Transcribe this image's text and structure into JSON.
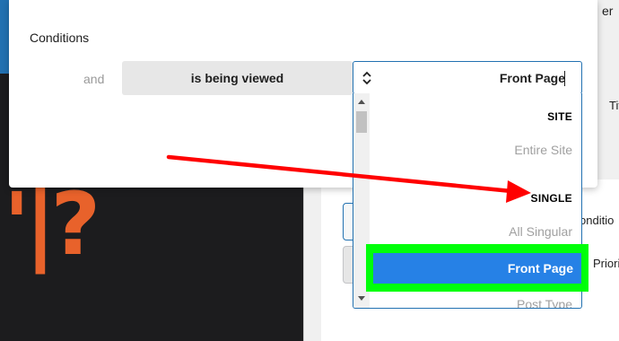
{
  "modal": {
    "title": "Conditions",
    "connector": "and",
    "condition_label": "is being viewed",
    "select_value": "Front Page",
    "select_icon": "chevron-up-down-icon"
  },
  "dropdown": {
    "groups": [
      {
        "label": "SITE",
        "options": [
          "Entire Site"
        ]
      },
      {
        "label": "SINGLE",
        "options": [
          "All Singular",
          "Front Page",
          "Post Type"
        ]
      }
    ],
    "selected_option": "Front Page"
  },
  "sidebar": {
    "header_fragment": "er",
    "row_fragments": [
      "Tit",
      "onditio",
      "Priori"
    ]
  },
  "background": {
    "logo_fragment": "'|?"
  },
  "annotations": {
    "arrow_color": "#ff0000",
    "highlight_color": "#00ff0a"
  },
  "colors": {
    "accent": "#2271b1",
    "selected": "#2681e6",
    "logo": "#e8622b"
  }
}
